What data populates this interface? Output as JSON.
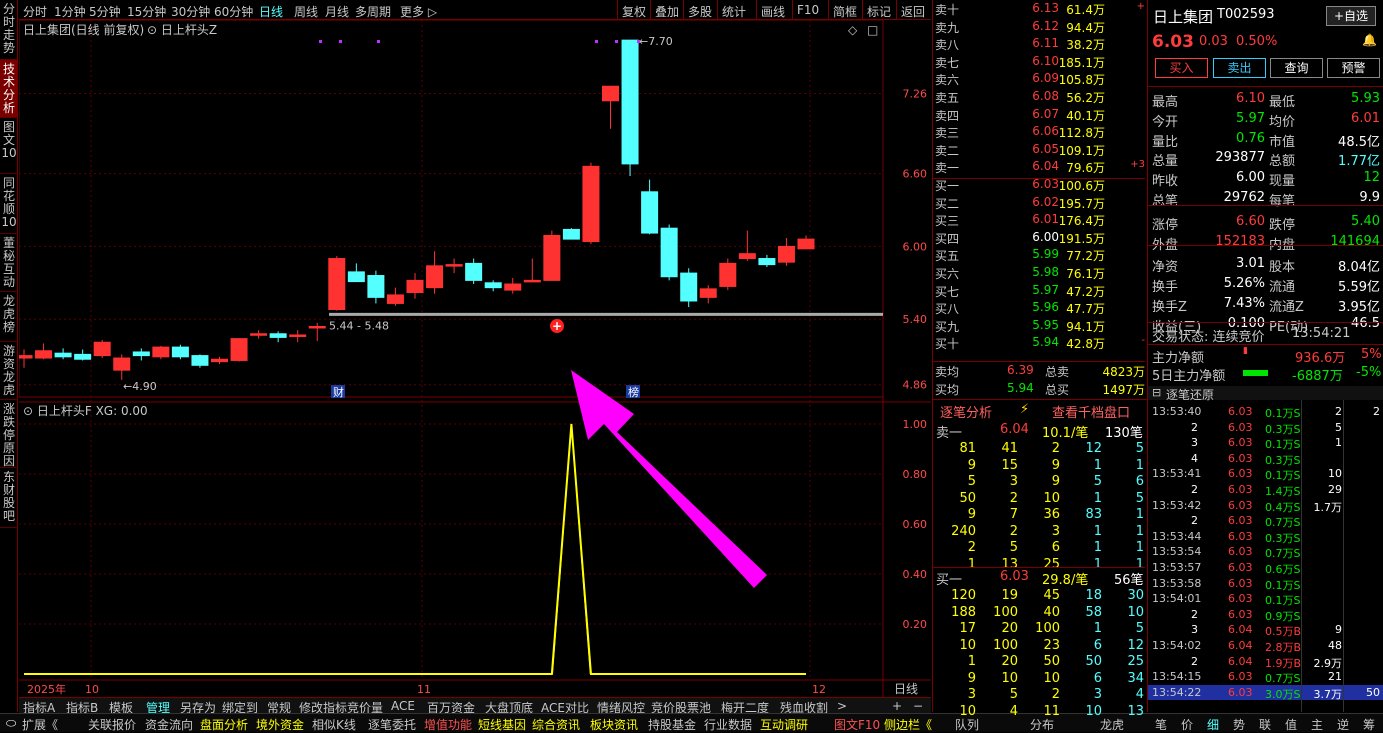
{
  "left_tabs": [
    "分时走势",
    "技术分析",
    "图文10",
    "同花顺10",
    "董秘互动",
    "龙虎榜",
    "游资龙虎",
    "涨跌停原因",
    "东财股吧"
  ],
  "toolbar": {
    "periods": [
      "分时",
      "1分钟",
      "5分钟",
      "15分钟",
      "30分钟",
      "60分钟",
      "日线",
      "周线",
      "月线",
      "多周期",
      "更多"
    ],
    "active": "日线",
    "right_buttons": [
      "复权",
      "叠加",
      "多股",
      "统计",
      "画线",
      "F10",
      "简框",
      "标记",
      "返回"
    ]
  },
  "chart": {
    "title": "日上集团(日线 前复权)",
    "indicator_name": "日上杆头Z",
    "high_mark": "7.70",
    "low_mark": "4.90",
    "range_label": "5.44 - 5.48",
    "event_1": "财",
    "event_2": "榜",
    "sub_title": "日上杆头F",
    "sub_value": "XG: 0.00",
    "x_labels": [
      "2025年",
      "10",
      "11",
      "12"
    ],
    "period_label": "日线"
  },
  "chart_data": [
    {
      "type": "candlestick",
      "title": "日上集团(日线 前复权)",
      "yticks": [
        "7.26",
        "6.60",
        "6.00",
        "5.40",
        "4.86"
      ],
      "ylim": [
        4.8,
        7.8
      ],
      "candles": [
        {
          "o": 5.1,
          "h": 5.15,
          "l": 5.0,
          "c": 5.08,
          "color": "red"
        },
        {
          "o": 5.14,
          "h": 5.2,
          "l": 5.07,
          "c": 5.08,
          "color": "red"
        },
        {
          "o": 5.12,
          "h": 5.16,
          "l": 5.07,
          "c": 5.09,
          "color": "cyan"
        },
        {
          "o": 5.11,
          "h": 5.15,
          "l": 5.06,
          "c": 5.07,
          "color": "cyan"
        },
        {
          "o": 5.1,
          "h": 5.23,
          "l": 5.08,
          "c": 5.21,
          "color": "red"
        },
        {
          "o": 5.08,
          "h": 5.11,
          "l": 4.9,
          "c": 4.98,
          "color": "red"
        },
        {
          "o": 5.1,
          "h": 5.16,
          "l": 5.06,
          "c": 5.13,
          "color": "cyan"
        },
        {
          "o": 5.09,
          "h": 5.18,
          "l": 5.07,
          "c": 5.17,
          "color": "red"
        },
        {
          "o": 5.17,
          "h": 5.19,
          "l": 5.07,
          "c": 5.09,
          "color": "cyan"
        },
        {
          "o": 5.1,
          "h": 5.11,
          "l": 5.0,
          "c": 5.02,
          "color": "cyan"
        },
        {
          "o": 5.05,
          "h": 5.09,
          "l": 5.03,
          "c": 5.07,
          "color": "red"
        },
        {
          "o": 5.06,
          "h": 5.24,
          "l": 5.05,
          "c": 5.24,
          "color": "red"
        },
        {
          "o": 5.28,
          "h": 5.31,
          "l": 5.24,
          "c": 5.27,
          "color": "red"
        },
        {
          "o": 5.28,
          "h": 5.3,
          "l": 5.21,
          "c": 5.25,
          "color": "cyan"
        },
        {
          "o": 5.26,
          "h": 5.31,
          "l": 5.21,
          "c": 5.27,
          "color": "red"
        },
        {
          "o": 5.34,
          "h": 5.37,
          "l": 5.22,
          "c": 5.34,
          "color": "red"
        },
        {
          "o": 5.48,
          "h": 5.92,
          "l": 5.47,
          "c": 5.9,
          "color": "red"
        },
        {
          "o": 5.79,
          "h": 5.86,
          "l": 5.75,
          "c": 5.71,
          "color": "cyan"
        },
        {
          "o": 5.76,
          "h": 5.8,
          "l": 5.53,
          "c": 5.58,
          "color": "cyan"
        },
        {
          "o": 5.6,
          "h": 5.66,
          "l": 5.51,
          "c": 5.53,
          "color": "red"
        },
        {
          "o": 5.62,
          "h": 5.78,
          "l": 5.57,
          "c": 5.72,
          "color": "red"
        },
        {
          "o": 5.66,
          "h": 5.96,
          "l": 5.61,
          "c": 5.84,
          "color": "red"
        },
        {
          "o": 5.84,
          "h": 5.9,
          "l": 5.78,
          "c": 5.85,
          "color": "red"
        },
        {
          "o": 5.86,
          "h": 5.9,
          "l": 5.69,
          "c": 5.72,
          "color": "cyan"
        },
        {
          "o": 5.7,
          "h": 5.72,
          "l": 5.63,
          "c": 5.66,
          "color": "cyan"
        },
        {
          "o": 5.64,
          "h": 5.74,
          "l": 5.61,
          "c": 5.69,
          "color": "red"
        },
        {
          "o": 5.72,
          "h": 5.9,
          "l": 5.71,
          "c": 5.71,
          "color": "red"
        },
        {
          "o": 5.72,
          "h": 6.13,
          "l": 5.72,
          "c": 6.09,
          "color": "red"
        },
        {
          "o": 6.14,
          "h": 6.15,
          "l": 6.06,
          "c": 6.06,
          "color": "cyan"
        },
        {
          "o": 6.04,
          "h": 6.69,
          "l": 6.02,
          "c": 6.66,
          "color": "red"
        },
        {
          "o": 7.2,
          "h": 7.31,
          "l": 6.97,
          "c": 7.32,
          "color": "red"
        },
        {
          "o": 7.7,
          "h": 7.7,
          "l": 6.58,
          "c": 6.68,
          "color": "cyan"
        },
        {
          "o": 6.45,
          "h": 6.55,
          "l": 6.1,
          "c": 6.11,
          "color": "cyan"
        },
        {
          "o": 6.15,
          "h": 6.18,
          "l": 5.72,
          "c": 5.75,
          "color": "cyan"
        },
        {
          "o": 5.78,
          "h": 5.82,
          "l": 5.5,
          "c": 5.55,
          "color": "cyan"
        },
        {
          "o": 5.65,
          "h": 5.68,
          "l": 5.53,
          "c": 5.58,
          "color": "red"
        },
        {
          "o": 5.67,
          "h": 5.9,
          "l": 5.64,
          "c": 5.86,
          "color": "red"
        },
        {
          "o": 5.9,
          "h": 6.13,
          "l": 5.88,
          "c": 5.94,
          "color": "red"
        },
        {
          "o": 5.9,
          "h": 5.93,
          "l": 5.83,
          "c": 5.85,
          "color": "cyan"
        },
        {
          "o": 5.87,
          "h": 6.07,
          "l": 5.84,
          "c": 6.0,
          "color": "red"
        },
        {
          "o": 6.06,
          "h": 6.09,
          "l": 5.98,
          "c": 5.98,
          "color": "red"
        }
      ]
    },
    {
      "type": "line",
      "title": "日上杆头F",
      "yticks": [
        "1.00",
        "0.80",
        "0.60",
        "0.40",
        "0.20"
      ],
      "ylim": [
        0,
        1.0
      ],
      "series": [
        {
          "name": "XG",
          "values": [
            0,
            0,
            0,
            0,
            0,
            0,
            0,
            0,
            0,
            0,
            0,
            0,
            0,
            0,
            0,
            0,
            0,
            0,
            0,
            0,
            0,
            0,
            0,
            0,
            0,
            0,
            0,
            0,
            1,
            0,
            0,
            0,
            0,
            0,
            0,
            0,
            0,
            0,
            0,
            0,
            0
          ]
        }
      ]
    }
  ],
  "orderbook": {
    "asks": [
      {
        "label": "卖十",
        "price": "6.13",
        "vol": "61.4万",
        "mark": "+"
      },
      {
        "label": "卖九",
        "price": "6.12",
        "vol": "94.4万"
      },
      {
        "label": "卖八",
        "price": "6.11",
        "vol": "38.2万"
      },
      {
        "label": "卖七",
        "price": "6.10",
        "vol": "185.1万"
      },
      {
        "label": "卖六",
        "price": "6.09",
        "vol": "105.8万"
      },
      {
        "label": "卖五",
        "price": "6.08",
        "vol": "56.2万"
      },
      {
        "label": "卖四",
        "price": "6.07",
        "vol": "40.1万"
      },
      {
        "label": "卖三",
        "price": "6.06",
        "vol": "112.8万"
      },
      {
        "label": "卖二",
        "price": "6.05",
        "vol": "109.1万"
      },
      {
        "label": "卖一",
        "price": "6.04",
        "vol": "79.6万",
        "mark": "+3"
      }
    ],
    "bids": [
      {
        "label": "买一",
        "price": "6.03",
        "vol": "100.6万"
      },
      {
        "label": "买二",
        "price": "6.02",
        "vol": "195.7万"
      },
      {
        "label": "买三",
        "price": "6.01",
        "vol": "176.4万"
      },
      {
        "label": "买四",
        "price": "6.00",
        "vol": "191.5万"
      },
      {
        "label": "买五",
        "price": "5.99",
        "vol": "77.2万"
      },
      {
        "label": "买六",
        "price": "5.98",
        "vol": "76.1万"
      },
      {
        "label": "买七",
        "price": "5.97",
        "vol": "47.2万"
      },
      {
        "label": "买八",
        "price": "5.96",
        "vol": "47.7万"
      },
      {
        "label": "买九",
        "price": "5.95",
        "vol": "94.1万"
      },
      {
        "label": "买十",
        "price": "5.94",
        "vol": "42.8万",
        "mark": "-"
      }
    ],
    "ask_avg_label": "卖均",
    "ask_avg": "6.39",
    "ask_total_label": "总卖",
    "ask_total": "4823万",
    "bid_avg_label": "买均",
    "bid_avg": "5.94",
    "bid_total_label": "总买",
    "bid_total": "1497万"
  },
  "tick_analysis": {
    "tab1": "逐笔分析",
    "tab2": "查看千档盘口",
    "ask1_label": "卖一",
    "ask1_price": "6.04",
    "ask1_per": "10.1/笔",
    "ask1_count": "130笔",
    "ask_rows": [
      [
        "81",
        "41",
        "2",
        "12",
        "5"
      ],
      [
        "9",
        "15",
        "9",
        "1",
        "1"
      ],
      [
        "5",
        "3",
        "9",
        "5",
        "6"
      ],
      [
        "50",
        "2",
        "10",
        "1",
        "5"
      ],
      [
        "9",
        "7",
        "36",
        "83",
        "1"
      ],
      [
        "240",
        "2",
        "3",
        "1",
        "1"
      ],
      [
        "2",
        "5",
        "6",
        "1",
        "1"
      ],
      [
        "1",
        "13",
        "25",
        "1",
        "1"
      ]
    ],
    "bid1_label": "买一",
    "bid1_price": "6.03",
    "bid1_per": "29.8/笔",
    "bid1_count": "56笔",
    "bid_rows": [
      [
        "120",
        "19",
        "45",
        "18",
        "30"
      ],
      [
        "188",
        "100",
        "40",
        "58",
        "10"
      ],
      [
        "17",
        "20",
        "100",
        "1",
        "5"
      ],
      [
        "10",
        "100",
        "23",
        "6",
        "12"
      ],
      [
        "1",
        "20",
        "50",
        "50",
        "25"
      ],
      [
        "9",
        "10",
        "10",
        "6",
        "34"
      ],
      [
        "3",
        "5",
        "2",
        "3",
        "4"
      ],
      [
        "10",
        "4",
        "11",
        "10",
        "13"
      ]
    ]
  },
  "quote": {
    "name": "日上集团",
    "code": "002593",
    "price": "6.03",
    "change": "0.03",
    "pct": "0.50%",
    "self_select": "+自选",
    "buy": "买入",
    "sell": "卖出",
    "query": "查询",
    "alert": "预警",
    "rows": [
      [
        "最高",
        "6.10",
        "最低",
        "5.93"
      ],
      [
        "今开",
        "5.97",
        "均价",
        "6.01"
      ],
      [
        "量比",
        "0.76",
        "市值",
        "48.5亿"
      ],
      [
        "总量",
        "293877",
        "总额",
        "1.77亿"
      ],
      [
        "昨收",
        "6.00",
        "现量",
        "12"
      ],
      [
        "总笔",
        "29762",
        "每笔",
        "9.9"
      ],
      [
        "涨停",
        "6.60",
        "跌停",
        "5.40"
      ],
      [
        "外盘",
        "152183",
        "内盘",
        "141694"
      ],
      [
        "净资",
        "3.01",
        "股本",
        "8.04亿"
      ],
      [
        "换手",
        "5.26%",
        "流通",
        "5.59亿"
      ],
      [
        "换手Z",
        "7.43%",
        "流通Z",
        "3.95亿"
      ],
      [
        "收益(三)",
        "0.100",
        "PE(动)",
        "46.5"
      ]
    ],
    "trade_state": "交易状态: 连续竞价",
    "trade_time": "13:54:21",
    "main_net_label": "主力净额",
    "main_net": "936.6万",
    "main_net_pct": "5%",
    "main5_label": "5日主力净额",
    "main5": "-6887万",
    "main5_pct": "-5%"
  },
  "ticks_panel": {
    "title": "逐笔还原",
    "rows": [
      [
        "13:53:40",
        "6.03",
        "0.1万S",
        "2",
        "2"
      ],
      [
        "",
        "2",
        "6.03",
        "0.3万S",
        "5"
      ],
      [
        "",
        "3",
        "6.03",
        "0.1万S",
        "1"
      ],
      [
        "",
        "4",
        "6.03",
        "0.3万S",
        ""
      ],
      [
        "13:53:41",
        "6.03",
        "0.1万S",
        "10",
        ""
      ],
      [
        "",
        "2",
        "6.03",
        "1.4万S",
        "29"
      ],
      [
        "13:53:42",
        "6.03",
        "0.4万S",
        "1.7万",
        ""
      ],
      [
        "",
        "2",
        "6.03",
        "0.7万S",
        ""
      ],
      [
        "13:53:44",
        "6.03",
        "0.3万S",
        "",
        ""
      ],
      [
        "13:53:54",
        "6.03",
        "0.7万S",
        "",
        ""
      ],
      [
        "13:53:57",
        "6.03",
        "0.6万S",
        "",
        ""
      ],
      [
        "13:53:58",
        "6.03",
        "0.1万S",
        "",
        ""
      ],
      [
        "13:54:01",
        "6.03",
        "0.1万S",
        "",
        ""
      ],
      [
        "",
        "2",
        "6.03",
        "0.9万S",
        ""
      ],
      [
        "",
        "3",
        "6.04",
        "0.5万B",
        "9"
      ],
      [
        "13:54:02",
        "6.04",
        "2.8万B",
        "48",
        ""
      ],
      [
        "",
        "2",
        "6.04",
        "1.9万B",
        "2.9万"
      ],
      [
        "13:54:15",
        "6.03",
        "0.7万S",
        "21",
        ""
      ],
      [
        "13:54:22",
        "6.03",
        "3.0万S",
        "3.7万",
        "50"
      ]
    ],
    "side_numbers": [
      "2",
      "2",
      "11",
      "0.7万",
      "1",
      "1.7万",
      "11",
      "1.0万",
      "1",
      "2",
      "58",
      "3.5万",
      "3",
      "55",
      "3.3万",
      "5",
      "3",
      "50"
    ]
  },
  "bottom_tabs": [
    "指标A",
    "指标B",
    "模板",
    "管理",
    "另存为",
    "绑定到",
    "常规",
    "修改指标",
    "竞价量",
    "ACE",
    "百万资金",
    "大盘顶底",
    "ACE对比",
    "情绪风控",
    "竞价股票池",
    "梅开二度",
    "残血收割"
  ],
  "bottom_active": "管理",
  "status": [
    "扩展",
    "关联报价",
    "资金流向",
    "盘面分析",
    "境外资金",
    "相似K线",
    "逐笔委托",
    "增值功能",
    "短线基因",
    "综合资讯",
    "板块资讯",
    "持股基金",
    "行业数据",
    "互动调研"
  ],
  "status_right": [
    "图文F10",
    "侧边栏"
  ],
  "right_bottom_tabs": [
    "队列",
    "分布",
    "龙虎"
  ],
  "right_bottom_tabs2": [
    "笔",
    "价",
    "细",
    "势",
    "联",
    "值",
    "主",
    "逆",
    "筹"
  ]
}
